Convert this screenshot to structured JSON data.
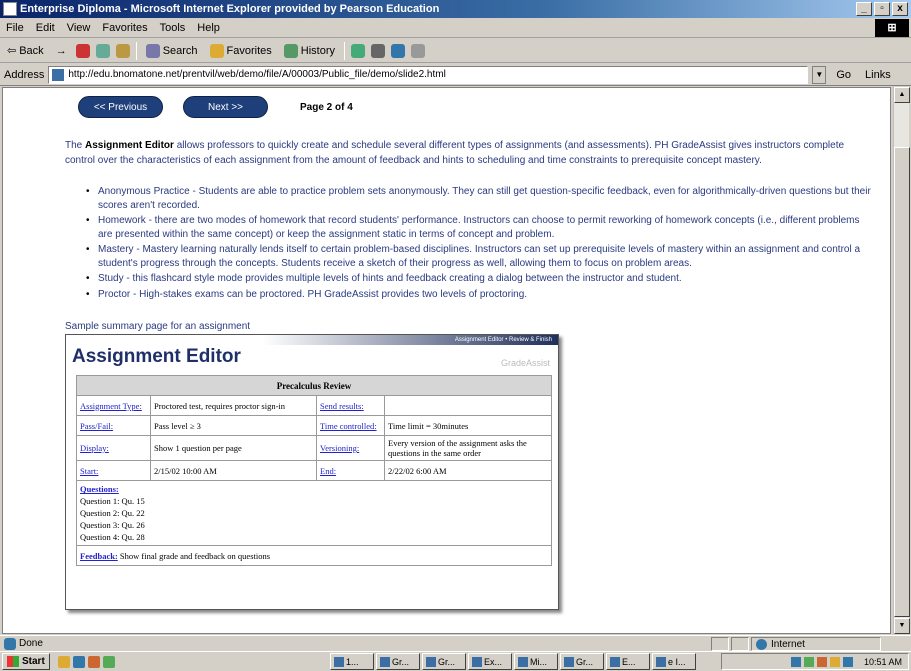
{
  "window": {
    "title": "Enterprise Diploma - Microsoft Internet Explorer provided by Pearson Education",
    "controls": [
      "_",
      "▫",
      "x"
    ]
  },
  "menu": [
    "File",
    "Edit",
    "View",
    "Favorites",
    "Tools",
    "Help"
  ],
  "toolbar": {
    "back": "Back",
    "forward": "→",
    "search": "Search",
    "favorites": "Favorites",
    "history": "History"
  },
  "address": {
    "label": "Address",
    "url": "http://edu.bnomatone.net/prentvil/web/demo/file/A/00003/Public_file/demo/slide2.html",
    "go": "Go",
    "links": "Links"
  },
  "nav": {
    "prev": "<< Previous",
    "next": "Next >>",
    "page": "Page 2 of 4"
  },
  "intro": {
    "lead": "The ",
    "bold": "Assignment Editor",
    "rest": " allows professors to quickly create and schedule several different types of assignments (and assessments). PH GradeAssist gives instructors complete control over the characteristics of each assignment from the amount of feedback and hints to scheduling and time constraints to prerequisite concept mastery."
  },
  "bullets": [
    "Anonymous Practice - Students are able to practice problem sets anonymously. They can still get question-specific feedback, even for algorithmically-driven questions but their scores aren't recorded.",
    "Homework - there are two modes of homework that record students' performance. Instructors can choose to permit reworking of homework concepts (i.e., different problems are presented within the same concept) or keep the assignment static in terms of concept and problem.",
    "Mastery - Mastery learning naturally lends itself to certain problem-based disciplines. Instructors can set up prerequisite levels of mastery within an assignment and control a student's progress through the concepts. Students receive a sketch of their progress as well, allowing them to focus on problem areas.",
    "Study - this flashcard style mode provides multiple levels of hints and feedback creating a dialog between the instructor and student.",
    "Proctor - High-stakes exams can be proctored. PH GradeAssist provides two levels of proctoring."
  ],
  "sample_caption": "Sample summary page for an assignment",
  "panel": {
    "header_links": "Assignment Editor • Review & Finish",
    "title": "Assignment Editor",
    "brand": "GradeAssist",
    "table_title": "Precalculus Review",
    "rows": [
      {
        "k1": "Assignment Type:",
        "v1": "Proctored test, requires proctor sign-in",
        "k2": "Send results:",
        "v2": ""
      },
      {
        "k1": "Pass/Fail:",
        "v1": "Pass level ≥ 3",
        "k2": "Time controlled:",
        "v2": "Time limit = 30minutes"
      },
      {
        "k1": "Display:",
        "v1": "Show 1 question per page",
        "k2": "Versioning:",
        "v2": "Every version of the assignment asks the questions in the same order"
      },
      {
        "k1": "Start:",
        "v1": "2/15/02 10:00 AM",
        "k2": "End:",
        "v2": "2/22/02 6:00 AM"
      }
    ],
    "questions_label": "Questions:",
    "questions": [
      "Question 1: Qu. 15",
      "Question 2: Qu. 22",
      "Question 3: Qu. 26",
      "Question 4: Qu. 28"
    ],
    "feedback_label": "Feedback:",
    "feedback_value": "Show final grade and feedback on questions"
  },
  "status": {
    "left": "Done",
    "zone": "Internet"
  },
  "taskbar": {
    "start": "Start",
    "tasks": [
      "1...",
      "Gr...",
      "Gr...",
      "Ex...",
      "Mi...",
      "Gr...",
      "E...",
      "e I..."
    ],
    "clock": "10:51 AM"
  },
  "colors": {
    "nav_button": "#1f3f7a",
    "body_text": "#2a3a80",
    "link": "#2222cc"
  }
}
